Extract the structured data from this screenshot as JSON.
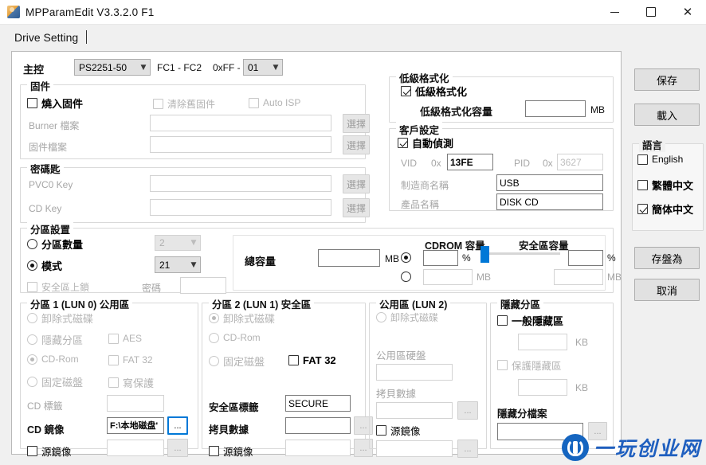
{
  "window": {
    "title": "MPParamEdit V3.3.2.0 F1",
    "icon": "app-user-card-icon",
    "minimize": "–",
    "maximize": "□",
    "close": "✕"
  },
  "tabs": [
    {
      "label": "Drive Setting"
    }
  ],
  "controller": {
    "label": "主控",
    "model": "PS2251-50",
    "fc_label": "FC1 - FC2",
    "hex_label": "0xFF -",
    "hex_value": "01"
  },
  "firmware": {
    "legend": "固件",
    "burn_checkbox": "燒入固件",
    "clear_old_checkbox": "清除舊固件",
    "auto_isp_checkbox": "Auto ISP",
    "burner_file_label": "Burner 檔案",
    "burner_file_value": "",
    "firmware_file_label": "固件檔案",
    "firmware_file_value": "",
    "browse_label": "選擇"
  },
  "key": {
    "legend": "密碼匙",
    "pvc0_label": "PVC0 Key",
    "pvc0_value": "",
    "cd_label": "CD Key",
    "cd_value": "",
    "browse_label": "選擇"
  },
  "lowformat": {
    "legend": "低級格式化",
    "enable_checkbox": "低級格式化",
    "enable_checked": true,
    "capacity_label": "低級格式化容量",
    "capacity_value": "",
    "unit": "MB"
  },
  "customer": {
    "legend": "客戶設定",
    "auto_detect_checkbox": "自動偵測",
    "auto_detect_checked": true,
    "vid_label": "VID",
    "vid_prefix": "0x",
    "vid_value": "13FE",
    "pid_label": "PID",
    "pid_prefix": "0x",
    "pid_value": "3627",
    "vendor_label": "制造商名稱",
    "vendor_value": "USB",
    "product_label": "產品名稱",
    "product_value": "DISK CD"
  },
  "partition_settings": {
    "legend": "分區設置",
    "count_radio": "分區數量",
    "count_selected": false,
    "count_value": "2",
    "mode_radio": "模式",
    "mode_selected": true,
    "mode_value": "21",
    "lock_checkbox": "安全區上鎖",
    "lock_checked": false,
    "password_label": "密碼",
    "password_value": "",
    "total_capacity_label": "總容量",
    "total_capacity_value": "",
    "total_capacity_unit": "MB",
    "cdrom_capacity_label": "CDROM 容量",
    "secure_capacity_label": "安全區容量",
    "percent_unit": "%",
    "mb_unit": "MB",
    "percent_mode_selected": true,
    "cdrom_percent_value": "",
    "cdrom_mb_value": "",
    "secure_percent_value": "",
    "secure_mb_value": "",
    "slider_position_percent": 0
  },
  "partition1": {
    "legend": "分區 1 (LUN 0) 公用區",
    "removable_radio": "卸除式磁碟",
    "hidden_radio": "隱藏分區",
    "cdrom_radio": "CD-Rom",
    "cdrom_selected": true,
    "fixed_radio": "固定磁盤",
    "aes_checkbox": "AES",
    "fat32_checkbox": "FAT 32",
    "writeprotect_checkbox": "寫保護",
    "cd_label_label": "CD 標籤",
    "cd_label_value": "",
    "cd_image_label": "CD 鏡像",
    "cd_image_value": "F:\\本地磁盘'",
    "source_image_checkbox": "源鏡像",
    "source_image_value": "",
    "browse_label": "..."
  },
  "partition2": {
    "legend": "分區 2 (LUN 1) 安全區",
    "removable_radio": "卸除式磁碟",
    "removable_selected": true,
    "cdrom_radio": "CD-Rom",
    "fixed_radio": "固定磁盤",
    "fat32_checkbox": "FAT 32",
    "secure_label_label": "安全區標籤",
    "secure_label_value": "SECURE",
    "copy_data_label": "拷貝數據",
    "copy_data_value": "",
    "source_image_checkbox": "源鏡像",
    "source_image_value": "",
    "browse_label": "..."
  },
  "partition3": {
    "legend": "公用區 (LUN 2)",
    "removable_radio": "卸除式磁碟",
    "disk_label": "公用區硬盤",
    "disk_value": "",
    "copy_data_label": "拷貝數據",
    "copy_data_value": "",
    "source_image_checkbox": "源鏡像",
    "source_image_value": "",
    "browse_label": "..."
  },
  "hidden_partition": {
    "legend": "隱藏分區",
    "general_checkbox": "一般隱藏區",
    "general_value": "",
    "general_unit": "KB",
    "protect_checkbox": "保護隱藏區",
    "protect_value": "",
    "protect_unit": "KB",
    "file_label": "隱藏分檔案",
    "file_value": "",
    "browse_label": "..."
  },
  "actions": {
    "save": "保存",
    "load": "載入",
    "save_as": "存盤為",
    "cancel": "取消"
  },
  "language": {
    "legend": "語言",
    "options": [
      {
        "label": "English",
        "checked": false
      },
      {
        "label": "繁體中文",
        "checked": false
      },
      {
        "label": "簡体中文",
        "checked": true
      }
    ]
  },
  "watermark": {
    "text": "一玩创业网",
    "logo": "circular-blue-logo"
  },
  "colors": {
    "accent": "#0078d7",
    "window_bg": "#f0f0f0",
    "panel_bg": "#ffffff"
  }
}
